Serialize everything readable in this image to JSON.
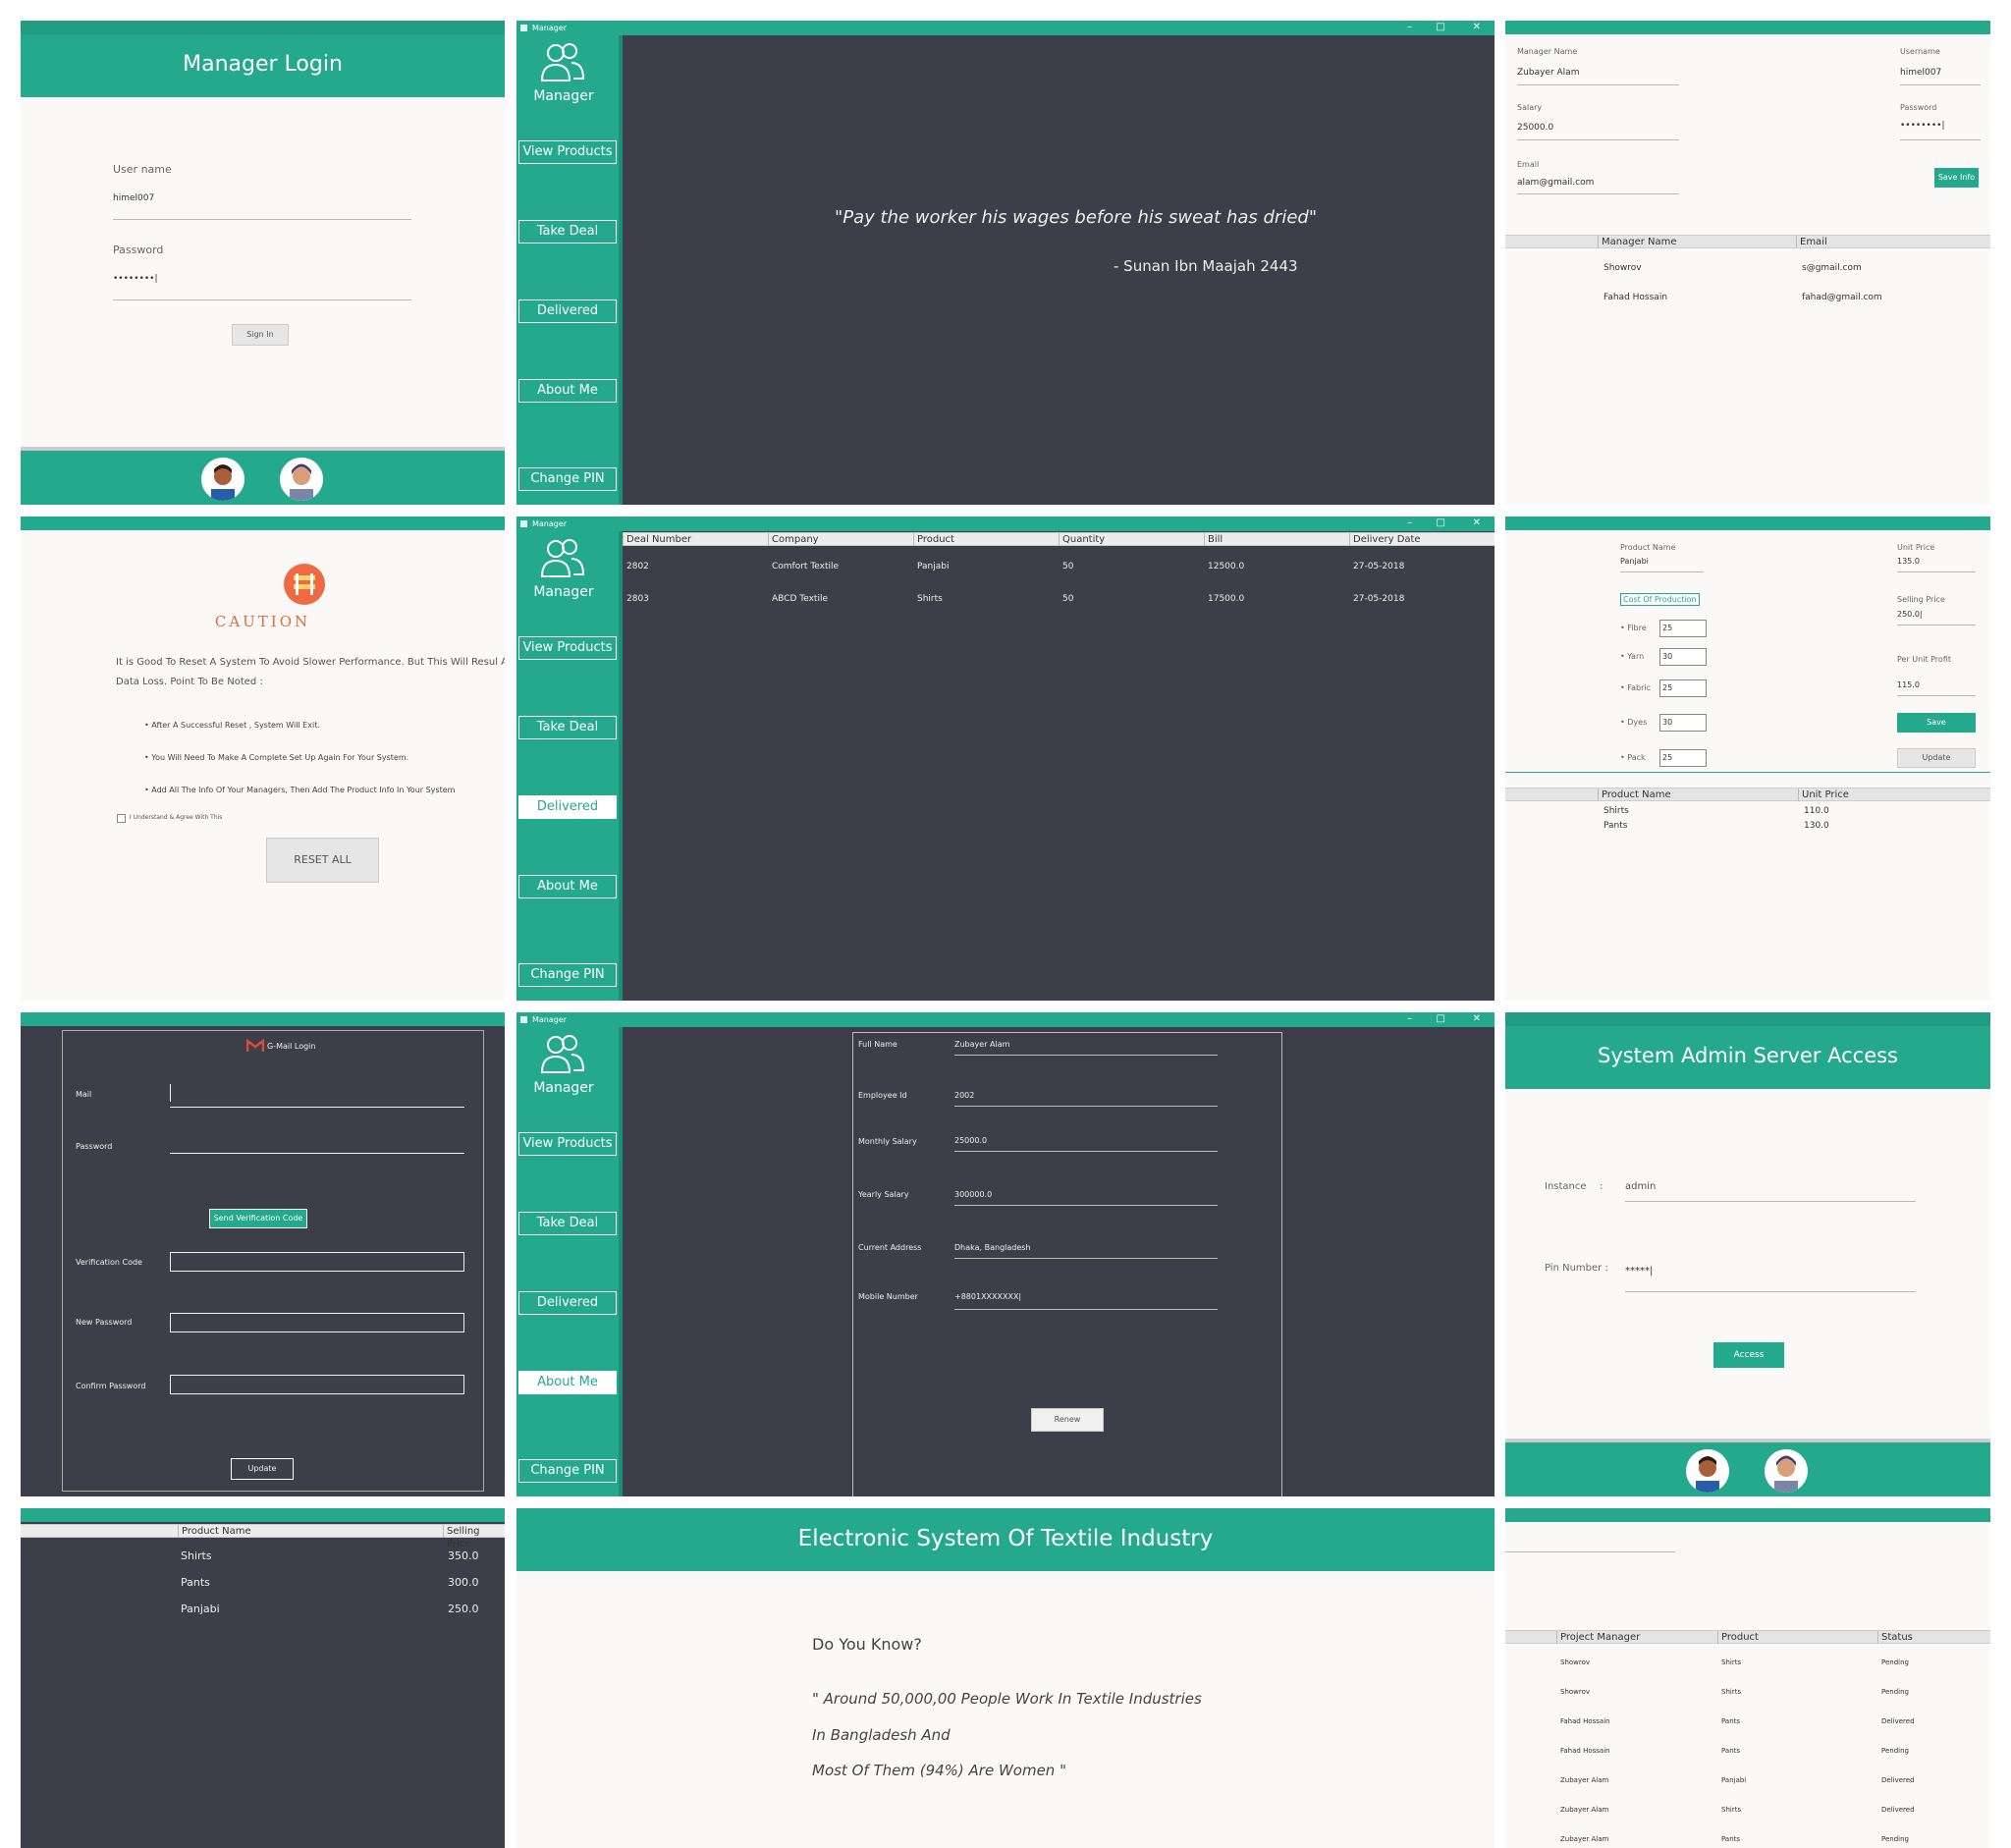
{
  "login": {
    "title": "Manager Login",
    "user_label": "User name",
    "user_value": "himel007",
    "pass_label": "Password",
    "pass_value": "••••••••|",
    "signin": "Sign In"
  },
  "window": {
    "title": "Manager"
  },
  "sidebar": {
    "label": "Manager",
    "items": [
      {
        "label": "View Products"
      },
      {
        "label": "Take Deal"
      },
      {
        "label": "Delivered"
      },
      {
        "label": "About Me"
      },
      {
        "label": "Change PIN"
      }
    ]
  },
  "quote": {
    "text": "\"Pay the worker his wages before his sweat has dried\"",
    "source": "- Sunan Ibn Maajah 2443"
  },
  "admin_form": {
    "manager_name_label": "Manager Name",
    "manager_name": "Zubayer Alam",
    "salary_label": "Salary",
    "salary": "25000.0",
    "email_label": "Email",
    "email": "alam@gmail.com",
    "username_label": "Username",
    "username": "himel007",
    "password_label": "Password",
    "password": "••••••••|",
    "save": "Save Info",
    "columns": [
      "Manager Name",
      "Email"
    ],
    "rows": [
      [
        "Showrov",
        "s@gmail.com"
      ],
      [
        "Fahad Hossain",
        "fahad@gmail.com"
      ]
    ]
  },
  "caution": {
    "title": "CAUTION",
    "para": "It is Good To Reset A System To Avoid Slower Performance. But This Will Resul A Data Loss. Point To Be Noted :",
    "bullets": [
      "• After A Successful Reset , System Will Exit.",
      "• You Will Need To Make A Complete Set Up Again For Your System.",
      "• Add All The Info Of Your Managers, Then Add The Product Info In Your System"
    ],
    "agree": "I Understand & Agree With This",
    "reset": "RESET ALL"
  },
  "deals": {
    "columns": [
      "Deal Number",
      "Company",
      "Product",
      "Quantity",
      "Bill",
      "Delivery Date"
    ],
    "rows": [
      [
        "2802",
        "Comfort Textile",
        "Panjabi",
        "50",
        "12500.0",
        "27-05-2018"
      ],
      [
        "2803",
        "ABCD Textile",
        "Shirts",
        "50",
        "17500.0",
        "27-05-2018"
      ]
    ]
  },
  "product_cost": {
    "product_name_label": "Product Name",
    "product_name": "Panjabi",
    "cost_label": "Cost Of Production",
    "items": [
      {
        "label": "• Fibre",
        "value": "25"
      },
      {
        "label": "• Yarn",
        "value": "30"
      },
      {
        "label": "• Fabric",
        "value": "25"
      },
      {
        "label": "• Dyes",
        "value": "30"
      },
      {
        "label": "• Pack",
        "value": "25"
      }
    ],
    "unit_price_label": "Unit Price",
    "unit_price": "135.0",
    "selling_price_label": "Selling Price",
    "selling_price": "250.0|",
    "profit_label": "Per Unit Profit",
    "profit": "115.0",
    "save": "Save",
    "update": "Update",
    "columns": [
      "Product Name",
      "Unit Price"
    ],
    "rows": [
      [
        "Shirts",
        "110.0"
      ],
      [
        "Pants",
        "130.0"
      ]
    ]
  },
  "gmail": {
    "title": "G-Mail Login",
    "mail_label": "Mail",
    "password_label": "Password",
    "send": "Send Verification Code",
    "code_label": "Verification Code",
    "new_label": "New Password",
    "confirm_label": "Confirm Password",
    "update": "Update"
  },
  "about": {
    "fields": [
      {
        "label": "Full Name",
        "value": "Zubayer Alam"
      },
      {
        "label": "Employee Id",
        "value": "2002"
      },
      {
        "label": "Monthly Salary",
        "value": "25000.0"
      },
      {
        "label": "Yearly Salary",
        "value": "300000.0"
      },
      {
        "label": "Current Address",
        "value": "Dhaka, Bangladesh"
      },
      {
        "label": "Mobile Number",
        "value": "+8801XXXXXXX|"
      }
    ],
    "renew": "Renew"
  },
  "server": {
    "title": "System Admin Server Access",
    "instance_label": "Instance",
    "colon": ":",
    "instance": "admin",
    "pin_label": "Pin Number :",
    "pin": "*****|",
    "access": "Access"
  },
  "selling": {
    "columns": [
      "Product Name",
      "Selling Price"
    ],
    "rows": [
      [
        "Shirts",
        "350.0"
      ],
      [
        "Pants",
        "300.0"
      ],
      [
        "Panjabi",
        "250.0"
      ]
    ]
  },
  "home": {
    "title": "Electronic System Of Textile Industry",
    "question": "Do You Know?",
    "lines": [
      "\" Around 50,000,00 People Work In Textile Industries",
      "In Bangladesh And",
      "Most Of Them (94%) Are Women \""
    ]
  },
  "status": {
    "columns": [
      "Project Manager",
      "Product",
      "Status"
    ],
    "rows": [
      [
        "Showrov",
        "Shirts",
        "Pending"
      ],
      [
        "Showrov",
        "Shirts",
        "Pending"
      ],
      [
        "Fahad Hossain",
        "Pants",
        "Delivered"
      ],
      [
        "Fahad Hossain",
        "Pants",
        "Pending"
      ],
      [
        "Zubayer Alam",
        "Panjabi",
        "Delivered"
      ],
      [
        "Zubayer Alam",
        "Shirts",
        "Delivered"
      ],
      [
        "Zubayer Alam",
        "Pants",
        "Pending"
      ]
    ]
  },
  "colors": {
    "teal": "#25a98d",
    "dark": "#3c3f4a",
    "light": "#faf9f8"
  }
}
